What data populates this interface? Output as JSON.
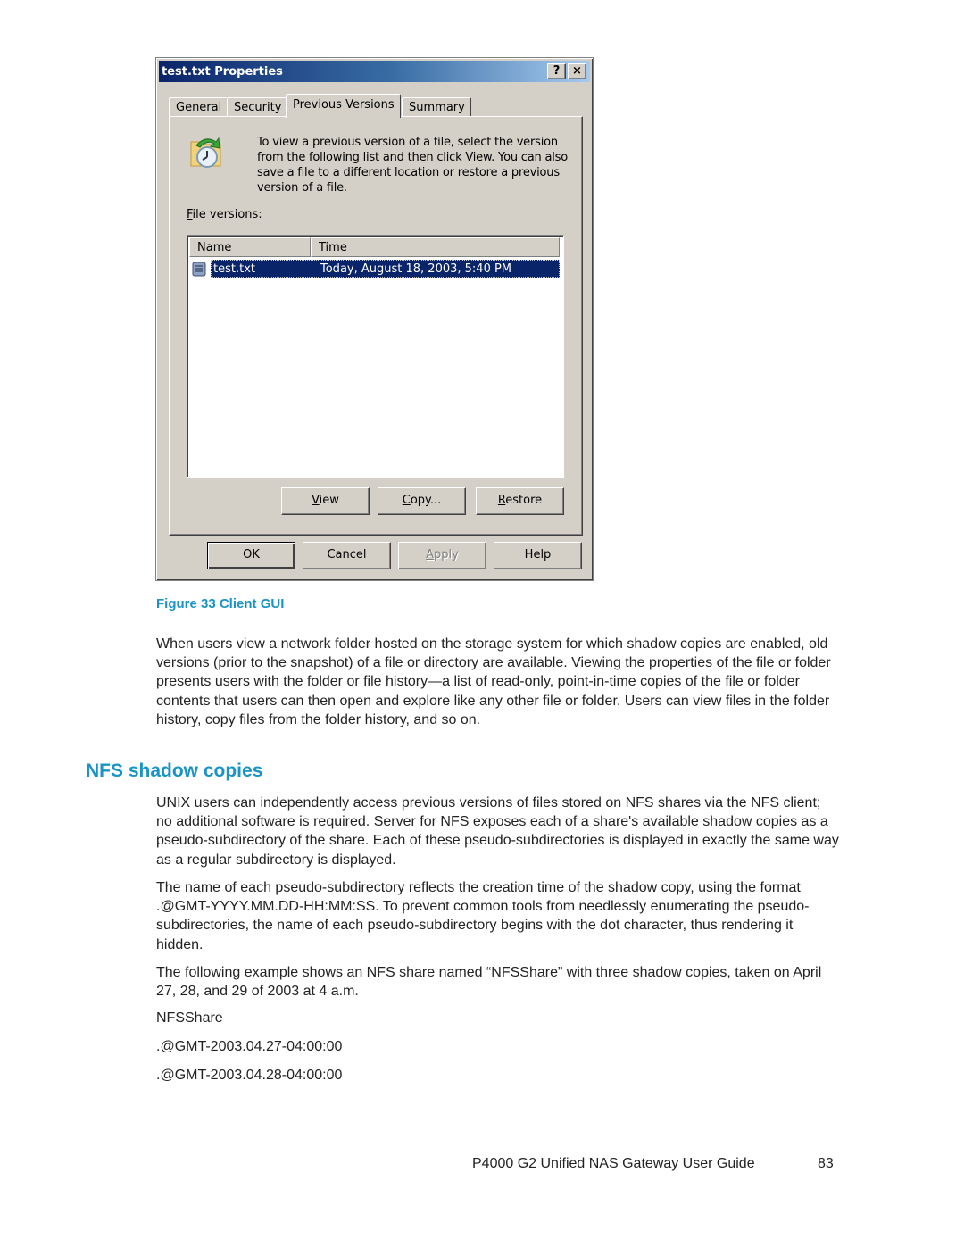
{
  "dialog": {
    "title": "test.txt Properties",
    "help_button": "?",
    "close_button": "×",
    "tabs": [
      {
        "label": "General",
        "active": false
      },
      {
        "label": "Security",
        "active": false
      },
      {
        "label": "Previous Versions",
        "active": true
      },
      {
        "label": "Summary",
        "active": false
      }
    ],
    "intro_text": "To view a previous version of a file, select the version from the following list and then click View.  You can also save a file to a different location or restore a previous version of a file.",
    "file_versions_label_accel": "F",
    "file_versions_label_rest": "ile versions:",
    "list": {
      "columns": [
        "Name",
        "Time"
      ],
      "rows": [
        {
          "name": "test.txt",
          "time": "Today, August 18, 2003, 5:40 PM",
          "selected": true
        }
      ]
    },
    "panel_buttons": {
      "view_accel": "V",
      "view_rest": "iew",
      "copy_accel": "C",
      "copy_rest": "opy...",
      "restore_accel": "R",
      "restore_rest": "estore"
    },
    "footer_buttons": {
      "ok": "OK",
      "cancel": "Cancel",
      "apply_accel": "A",
      "apply_rest": "pply",
      "help": "Help"
    },
    "colors": {
      "title_gradient_start": "#0a246a",
      "title_gradient_end": "#a6caf0",
      "face": "#d4d0c8",
      "selection": "#0a246a"
    }
  },
  "document": {
    "figure_caption": "Figure 33 Client GUI",
    "para1": "When users view a network folder hosted on the storage system for which shadow copies are enabled, old versions (prior to the snapshot) of a file or directory are available. Viewing the properties of the file or folder presents users with the folder or file history—a list of read-only, point-in-time copies of the file or folder contents that users can then open and explore like any other file or folder. Users can view files in the folder history, copy files from the folder history, and so on.",
    "section_heading": "NFS shadow copies",
    "para2": "UNIX users can independently access previous versions of files stored on NFS shares via the NFS client; no additional software is required. Server for NFS exposes each of a share's available shadow copies as a pseudo-subdirectory of the share. Each of these pseudo-subdirectories is displayed in exactly the same way as a regular subdirectory is displayed.",
    "para3": "The name of each pseudo-subdirectory reflects the creation time of the shadow copy, using the format .@GMT-YYYY.MM.DD-HH:MM:SS. To prevent common tools from needlessly enumerating the pseudo-subdirectories, the name of each pseudo-subdirectory begins with the dot character, thus rendering it hidden.",
    "para4": "The following example shows an NFS share named “NFSShare” with three shadow copies, taken on April 27, 28, and 29 of 2003 at 4 a.m.",
    "example_lines": [
      "NFSShare",
      ".@GMT-2003.04.27-04:00:00",
      ".@GMT-2003.04.28-04:00:00"
    ],
    "footer_title": "P4000 G2 Unified NAS Gateway User Guide",
    "page_number": "83",
    "accent_color": "#1a94c8"
  }
}
